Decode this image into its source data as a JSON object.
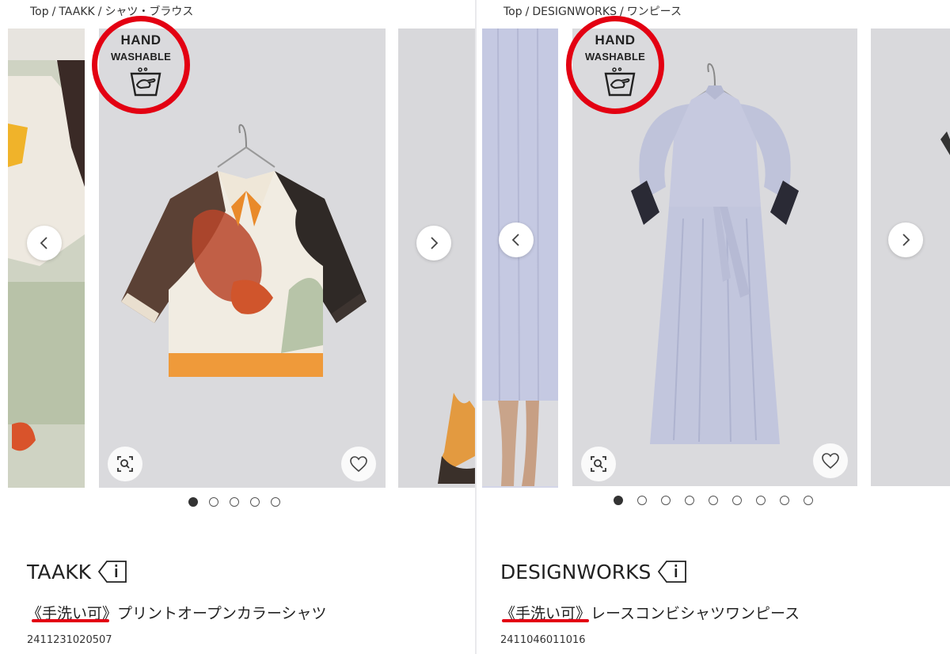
{
  "left": {
    "breadcrumb": {
      "top": "Top",
      "brand": "TAAKK",
      "category": "シャツ・ブラウス"
    },
    "badge": {
      "line1": "HAND",
      "line2": "WASHABLE"
    },
    "dots": {
      "count": 5,
      "active": 0
    },
    "brand": "TAAKK",
    "product_name": "《手洗い可》プリントオープンカラーシャツ",
    "product_code": "2411231020507"
  },
  "right": {
    "breadcrumb": {
      "top": "Top",
      "brand": "DESIGNWORKS",
      "category": "ワンピース"
    },
    "badge": {
      "line1": "HAND",
      "line2": "WASHABLE"
    },
    "dots": {
      "count": 9,
      "active": 0
    },
    "brand": "DESIGNWORKS",
    "product_name": "《手洗い可》レースコンビシャツワンピース",
    "product_code": "2411046011016"
  },
  "icons": {
    "prev": "chevron-left-icon",
    "next": "chevron-right-icon",
    "zoom": "zoom-search-icon",
    "favorite": "heart-icon",
    "info": "info-tag-icon",
    "wash": "hand-wash-icon"
  },
  "colors": {
    "highlight": "#e30012",
    "image_bg": "#d9d9dc"
  }
}
